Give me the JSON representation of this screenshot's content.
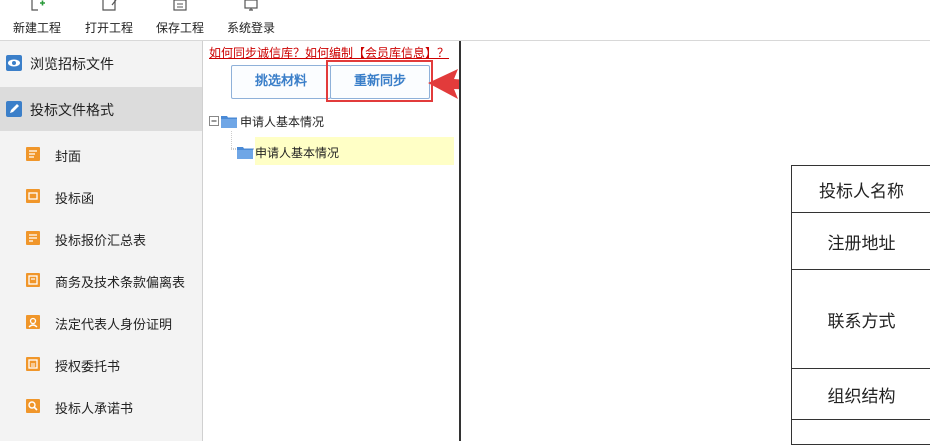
{
  "toolbar": {
    "items": [
      {
        "label": "新建工程",
        "icon": "new-project-icon"
      },
      {
        "label": "打开工程",
        "icon": "open-project-icon"
      },
      {
        "label": "保存工程",
        "icon": "save-project-icon"
      },
      {
        "label": "系统登录",
        "icon": "login-monitor-icon"
      }
    ]
  },
  "sidebar": {
    "top_items": [
      {
        "label": "浏览招标文件",
        "icon": "eye-icon"
      },
      {
        "label": "投标文件格式",
        "icon": "pencil-icon"
      }
    ],
    "sub_items": [
      {
        "label": "封面",
        "icon": "cover-doc-icon"
      },
      {
        "label": "投标函",
        "icon": "letter-doc-icon"
      },
      {
        "label": "投标报价汇总表",
        "icon": "price-doc-icon"
      },
      {
        "label": "商务及技术条款偏离表",
        "icon": "terms-doc-icon"
      },
      {
        "label": "法定代表人身份证明",
        "icon": "id-doc-icon"
      },
      {
        "label": "授权委托书",
        "icon": "authorization-doc-icon"
      },
      {
        "label": "投标人承诺书",
        "icon": "search-doc-icon"
      }
    ]
  },
  "middle": {
    "help_link": "如何同步诚信库？如何编制【会员库信息】？",
    "select_button": "挑选材料",
    "resync_button": "重新同步",
    "tree": {
      "root_label": "申请人基本情况",
      "child_label": "申请人基本情况"
    }
  },
  "document": {
    "rows": [
      "投标人名称",
      "注册地址",
      "联系方式",
      "组织结构"
    ]
  },
  "colors": {
    "accent_blue": "#3b7fc9",
    "icon_orange": "#f0962a",
    "annotation_red": "#e23b3b",
    "tree_selection": "#ffffc6",
    "link_red": "#cc0000"
  }
}
